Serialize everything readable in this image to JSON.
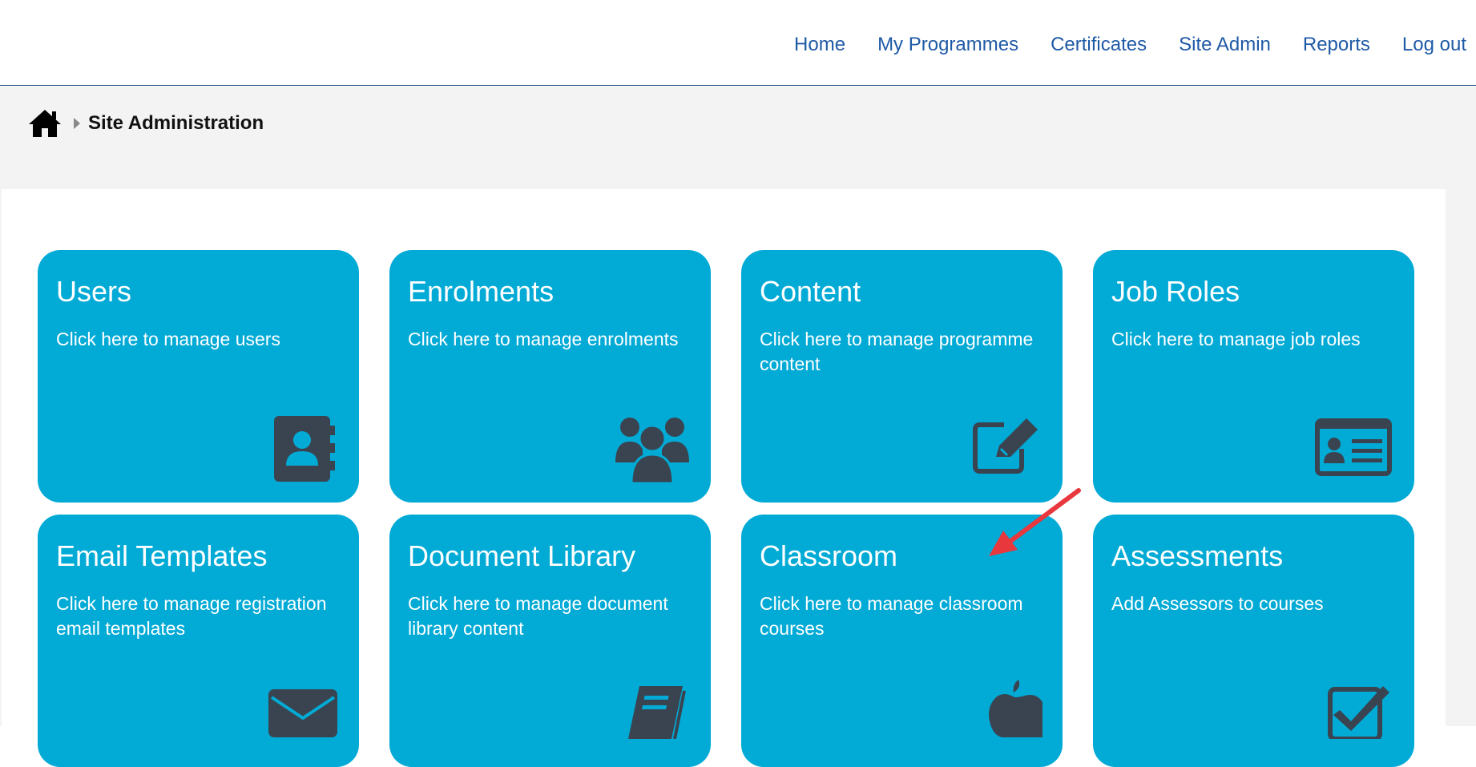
{
  "nav": {
    "items": [
      "Home",
      "My Programmes",
      "Certificates",
      "Site Admin",
      "Reports",
      "Log out"
    ]
  },
  "breadcrumb": {
    "home_icon": "home-icon",
    "separator_icon": "caret-right-icon",
    "title": "Site Administration"
  },
  "tiles": [
    {
      "title": "Users",
      "desc": "Click here to manage users",
      "icon": "address-book-icon"
    },
    {
      "title": "Enrolments",
      "desc": "Click here to manage enrolments",
      "icon": "users-group-icon"
    },
    {
      "title": "Content",
      "desc": "Click here to manage programme content",
      "icon": "edit-pencil-icon"
    },
    {
      "title": "Job Roles",
      "desc": "Click here to manage job roles",
      "icon": "id-card-icon"
    },
    {
      "title": "Email Templates",
      "desc": "Click here to manage registration email templates",
      "icon": "envelope-icon"
    },
    {
      "title": "Document Library",
      "desc": "Click here to manage document library content",
      "icon": "book-icon"
    },
    {
      "title": "Classroom",
      "desc": "Click here to manage classroom courses",
      "icon": "apple-icon"
    },
    {
      "title": "Assessments",
      "desc": "Add Assessors to courses",
      "icon": "checkbox-icon"
    }
  ],
  "colors": {
    "tile": "#02aad6",
    "icon": "#3a4450",
    "nav_link": "#1f5aa6",
    "annotation_arrow": "#e8383d"
  }
}
